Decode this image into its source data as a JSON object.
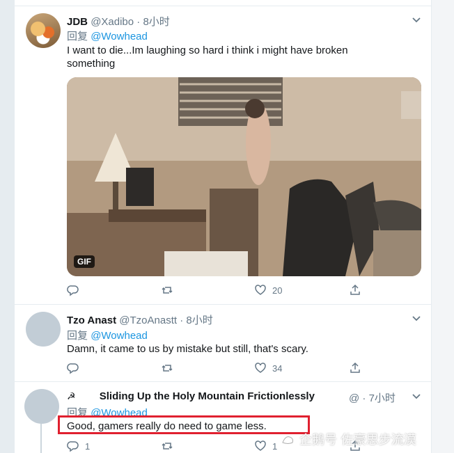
{
  "tweets": [
    {
      "name": "JDB",
      "handle": "@Xadibo",
      "dot": "·",
      "time": "8小时",
      "reply_label": "回复",
      "reply_to": "@Wowhead",
      "text": "I want to die...Im laughing so hard i think i might have broken something",
      "media_badge": "GIF",
      "actions": {
        "reply": "",
        "retweet": "",
        "like": "20",
        "share": ""
      }
    },
    {
      "name": "Tzo Anast",
      "handle": "@TzoAnastt",
      "dot": "·",
      "time": "8小时",
      "reply_label": "回复",
      "reply_to": "@Wowhead",
      "text": "Damn, it came to us by mistake but still, that's scary.",
      "actions": {
        "reply": "",
        "retweet": "",
        "like": "34",
        "share": ""
      }
    },
    {
      "name_icon": "☭",
      "name": "Sliding Up the Holy Mountain Frictionlessly",
      "handle": "@",
      "dot": "·",
      "time": "7小时",
      "reply_label": "回复",
      "reply_to": "@Wowhead",
      "text": "Good, gamers really do need to game less.",
      "actions": {
        "reply": "1",
        "retweet": "",
        "like": "1",
        "share": ""
      }
    }
  ],
  "watermark": "企鹅号 佐豪思步流漠",
  "colors": {
    "link": "#1b95e0",
    "muted": "#657786",
    "highlight_box": "#e0202f"
  }
}
